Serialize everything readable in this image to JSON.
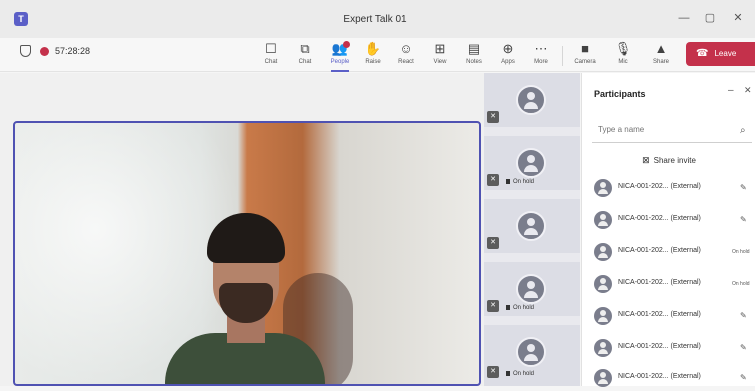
{
  "window": {
    "title": "Expert Talk 01",
    "minimize": "—",
    "maximize": "▢",
    "close": "✕"
  },
  "meeting": {
    "timer": "57:28:28"
  },
  "toolbar": {
    "items": [
      {
        "label": "Chat",
        "icon": "chat-icon",
        "glyph": "☐"
      },
      {
        "label": "Chat",
        "icon": "copy-icon",
        "glyph": "⧉"
      },
      {
        "label": "People",
        "icon": "people-icon",
        "glyph": "👥"
      },
      {
        "label": "Raise",
        "icon": "hand-icon",
        "glyph": "✋"
      },
      {
        "label": "React",
        "icon": "react-icon",
        "glyph": "☺"
      },
      {
        "label": "View",
        "icon": "view-icon",
        "glyph": "⊞"
      },
      {
        "label": "Notes",
        "icon": "notes-icon",
        "glyph": "▤"
      },
      {
        "label": "Apps",
        "icon": "apps-icon",
        "glyph": "⊕"
      },
      {
        "label": "More",
        "icon": "more-icon",
        "glyph": "⋯"
      },
      {
        "label": "Camera",
        "icon": "camera-icon",
        "glyph": "■"
      },
      {
        "label": "Mic",
        "icon": "mic-icon",
        "glyph": "🎙"
      },
      {
        "label": "Share",
        "icon": "share-icon",
        "glyph": "▲"
      }
    ],
    "leave_label": "Leave",
    "leave_icon": "☎"
  },
  "tiles": [
    {
      "status": ""
    },
    {
      "status": "On hold"
    },
    {
      "status": ""
    },
    {
      "status": "On hold"
    },
    {
      "status": "On hold"
    }
  ],
  "participants": {
    "title": "Participants",
    "search_placeholder": "Type a name",
    "share_label": "Share invite",
    "rows": [
      {
        "name": "NICA-001-202... (External)",
        "status": "✎"
      },
      {
        "name": "NICA-001-202... (External)",
        "status": "✎"
      },
      {
        "name": "NICA-001-202... (External)",
        "status": "On hold"
      },
      {
        "name": "NICA-001-202... (External)",
        "status": "On hold"
      },
      {
        "name": "NICA-001-202... (External)",
        "status": "✎"
      },
      {
        "name": "NICA-001-202... (External)",
        "status": "✎"
      },
      {
        "name": "NICA-001-202... (External)",
        "status": "✎"
      }
    ]
  },
  "colors": {
    "accent": "#5b5fc7",
    "leave": "#c4314b",
    "video_border": "#4f52b2"
  }
}
